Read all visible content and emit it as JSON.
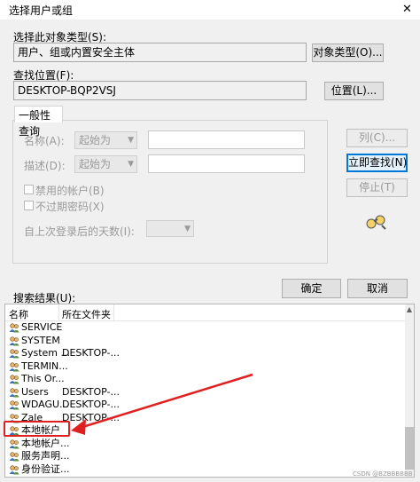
{
  "window": {
    "title": "选择用户或组",
    "close_glyph": "✕"
  },
  "object_type": {
    "label": "选择此对象类型(S):",
    "value": "用户、组或内置安全主体",
    "button": "对象类型(O)..."
  },
  "location": {
    "label": "查找位置(F):",
    "value": "DESKTOP-BQP2VSJ",
    "button": "位置(L)..."
  },
  "general_query": {
    "tab_label": "一般性查询",
    "name_label": "名称(A):",
    "name_mode": "起始为",
    "desc_label": "描述(D):",
    "desc_mode": "起始为",
    "disabled_accounts_label": "禁用的帐户(B)",
    "non_expiring_pwd_label": "不过期密码(X)",
    "days_since_logon_label": "自上次登录后的天数(I):"
  },
  "buttons": {
    "columns": "列(C)...",
    "find_now": "立即查找(N)",
    "stop": "停止(T)",
    "ok": "确定",
    "cancel": "取消"
  },
  "results": {
    "label": "搜索结果(U):",
    "columns": [
      "名称",
      "所在文件夹"
    ],
    "rows": [
      {
        "name": "SERVICE",
        "folder": ""
      },
      {
        "name": "SYSTEM",
        "folder": ""
      },
      {
        "name": "System ...",
        "folder": "DESKTOP-..."
      },
      {
        "name": "TERMIN...",
        "folder": ""
      },
      {
        "name": "This Or...",
        "folder": ""
      },
      {
        "name": "Users",
        "folder": "DESKTOP-..."
      },
      {
        "name": "WDAGU...",
        "folder": "DESKTOP-..."
      },
      {
        "name": "Zale",
        "folder": "DESKTOP-..."
      },
      {
        "name": "本地帐户",
        "folder": ""
      },
      {
        "name": "本地帐户...",
        "folder": ""
      },
      {
        "name": "服务声明...",
        "folder": ""
      },
      {
        "name": "身份验证...",
        "folder": ""
      }
    ]
  },
  "watermark": "CSDN @BZBBBBBB",
  "colors": {
    "accent": "#0078d7",
    "annotation": "#e02020"
  },
  "icons": {
    "user": "user-group-icon",
    "find": "binoculars-icon"
  }
}
